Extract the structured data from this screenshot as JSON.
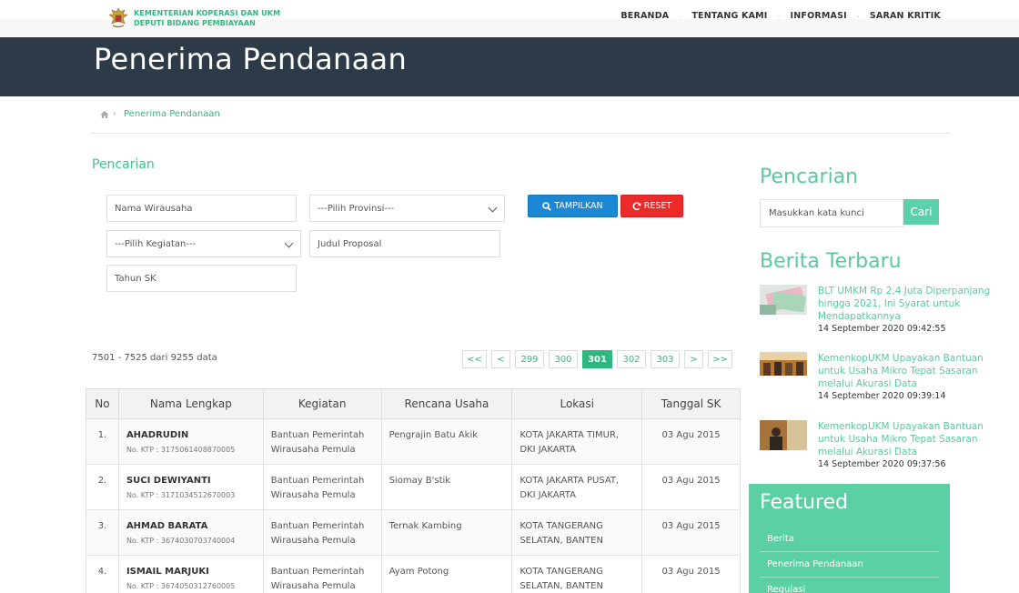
{
  "header": {
    "brand_line1": "KEMENTERIAN KOPERASI DAN UKM",
    "brand_line2": "DEPUTI BIDANG PEMBIAYAAN",
    "nav": [
      "BERANDA",
      "TENTANG KAMI",
      "INFORMASI",
      "SARAN KRITIK"
    ]
  },
  "page_title": "Penerima Pendanaan",
  "breadcrumb": {
    "current": "Penerima Pendanaan"
  },
  "search": {
    "title": "Pencarian",
    "nama_placeholder": "Nama Wirausaha",
    "provinsi_selected": "---Pilih Provinsi---",
    "kegiatan_selected": "---Pilih Kegiatan---",
    "judul_placeholder": "Judul Proposal",
    "tahun_placeholder": "Tahun SK",
    "show_label": "TAMPILKAN",
    "reset_label": "RESET"
  },
  "result_count": "7501 - 7525 dari 9255 data",
  "pagination": [
    "<<",
    "<",
    "299",
    "300",
    "301",
    "302",
    "303",
    ">",
    ">>"
  ],
  "pagination_active": "301",
  "table": {
    "headers": [
      "No",
      "Nama Lengkap",
      "Kegiatan",
      "Rencana Usaha",
      "Lokasi",
      "Tanggal SK"
    ],
    "rows": [
      {
        "no": "1.",
        "nama": "AHADRUDIN",
        "ktp": "No. KTP : 3175061408870005",
        "kegiatan": "Bantuan Pemerintah Wirausaha Pemula",
        "rencana": "Pengrajin Batu Akik",
        "lokasi": "KOTA JAKARTA TIMUR, DKI JAKARTA",
        "tanggal": "03 Agu 2015"
      },
      {
        "no": "2.",
        "nama": "SUCI DEWIYANTI",
        "ktp": "No. KTP : 3171034512670003",
        "kegiatan": "Bantuan Pemerintah Wirausaha Pemula",
        "rencana": "Siomay B'stik",
        "lokasi": "KOTA JAKARTA PUSAT, DKI JAKARTA",
        "tanggal": "03 Agu 2015"
      },
      {
        "no": "3.",
        "nama": "AHMAD BARATA",
        "ktp": "No. KTP : 3674030703740004",
        "kegiatan": "Bantuan Pemerintah Wirausaha Pemula",
        "rencana": "Ternak Kambing",
        "lokasi": "KOTA TANGERANG SELATAN, BANTEN",
        "tanggal": "03 Agu 2015"
      },
      {
        "no": "4.",
        "nama": "ISMAIL MARJUKI",
        "ktp": "No. KTP : 3674050312760005",
        "kegiatan": "Bantuan Pemerintah Wirausaha Pemula",
        "rencana": "Ayam Potong",
        "lokasi": "KOTA TANGERANG SELATAN, BANTEN",
        "tanggal": "03 Agu 2015"
      }
    ]
  },
  "sidebar": {
    "search_title": "Pencarian",
    "search_placeholder": "Masukkan kata kunci",
    "search_button": "Cari",
    "news_title": "Berita Terbaru",
    "news": [
      {
        "title": "BLT UMKM Rp 2,4 Juta Diperpanjang hingga 2021, Ini Syarat untuk Mendapatkannya",
        "date": "14 September 2020 09:42:55"
      },
      {
        "title": "KemenkopUKM Upayakan Bantuan untuk Usaha Mikro Tepat Sasaran melalui Akurasi Data",
        "date": "14 September 2020 09:39:14"
      },
      {
        "title": "KemenkopUKM Upayakan Bantuan untuk Usaha Mikro Tepat Sasaran melalui Akurasi Data",
        "date": "14 September 2020 09:37:56"
      }
    ],
    "featured_title": "Featured",
    "featured_items": [
      "Berita",
      "Penerima Pendanaan",
      "Regulasi"
    ]
  },
  "colors": {
    "accent": "#2eb87f",
    "header_band": "#2d3a48",
    "button_blue": "#1c87d3",
    "button_red": "#ec2a2a",
    "featured_bg": "#5ad0a3"
  }
}
